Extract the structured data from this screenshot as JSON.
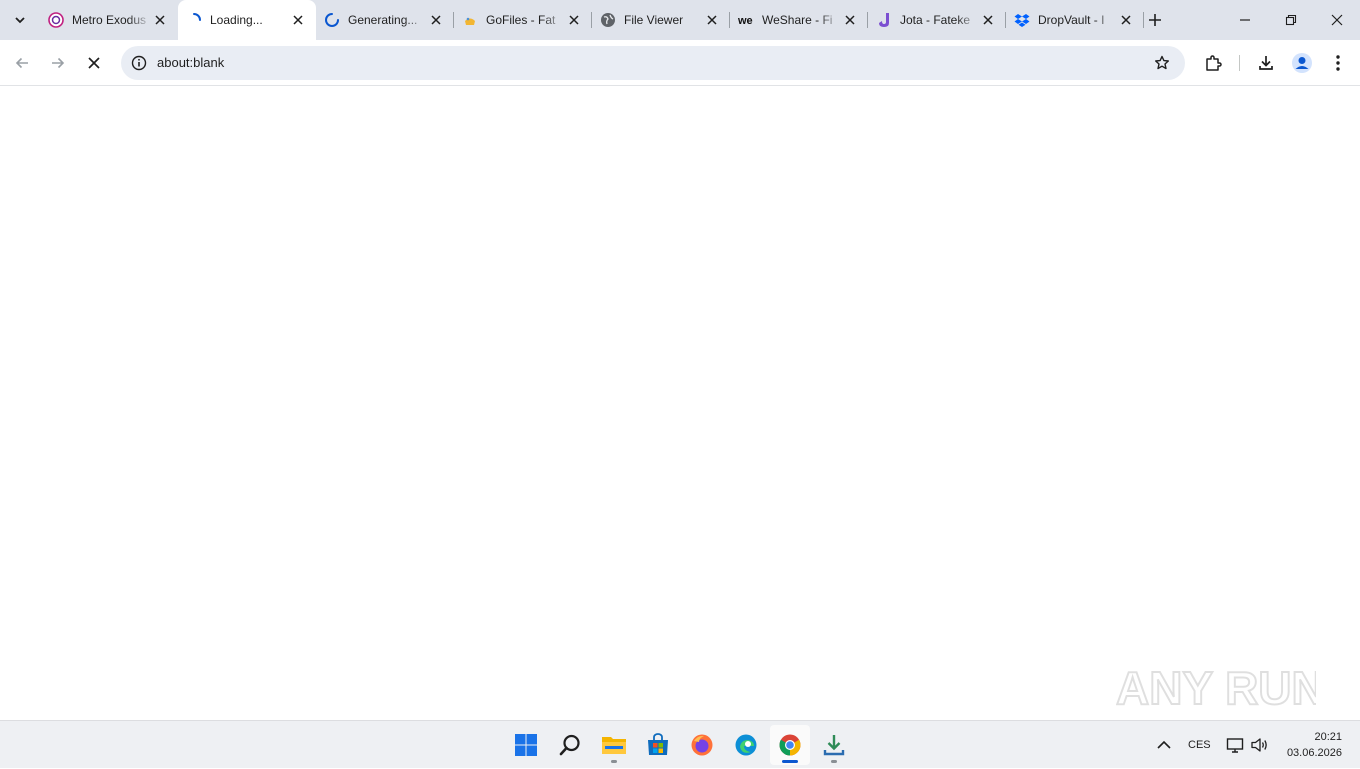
{
  "tabs": [
    {
      "title": "Metro Exodus",
      "favicon": "metro-favicon",
      "active": false
    },
    {
      "title": "Loading...",
      "favicon": "loading-spinner",
      "active": true
    },
    {
      "title": "Generating...",
      "favicon": "loading-spinner",
      "active": false
    },
    {
      "title": "GoFiles - Fat",
      "favicon": "gofiles-favicon",
      "active": false
    },
    {
      "title": "File Viewer",
      "favicon": "globe-icon",
      "active": false
    },
    {
      "title": "WeShare - Fi",
      "favicon": "weshare-favicon",
      "active": false
    },
    {
      "title": "Jota - Fateke",
      "favicon": "jota-favicon",
      "active": false
    },
    {
      "title": "DropVault - I",
      "favicon": "dropbox-favicon",
      "active": false
    }
  ],
  "omnibox": {
    "url": "about:blank"
  },
  "watermark": {
    "text": "ANY RUN"
  },
  "tray": {
    "language": "CES"
  },
  "clock": {
    "time": "20:21",
    "date": "03.06.2026"
  },
  "colors": {
    "accent": "#0b57d0",
    "tabstrip": "#dfe3eb",
    "omnibox": "#e9edf4"
  }
}
